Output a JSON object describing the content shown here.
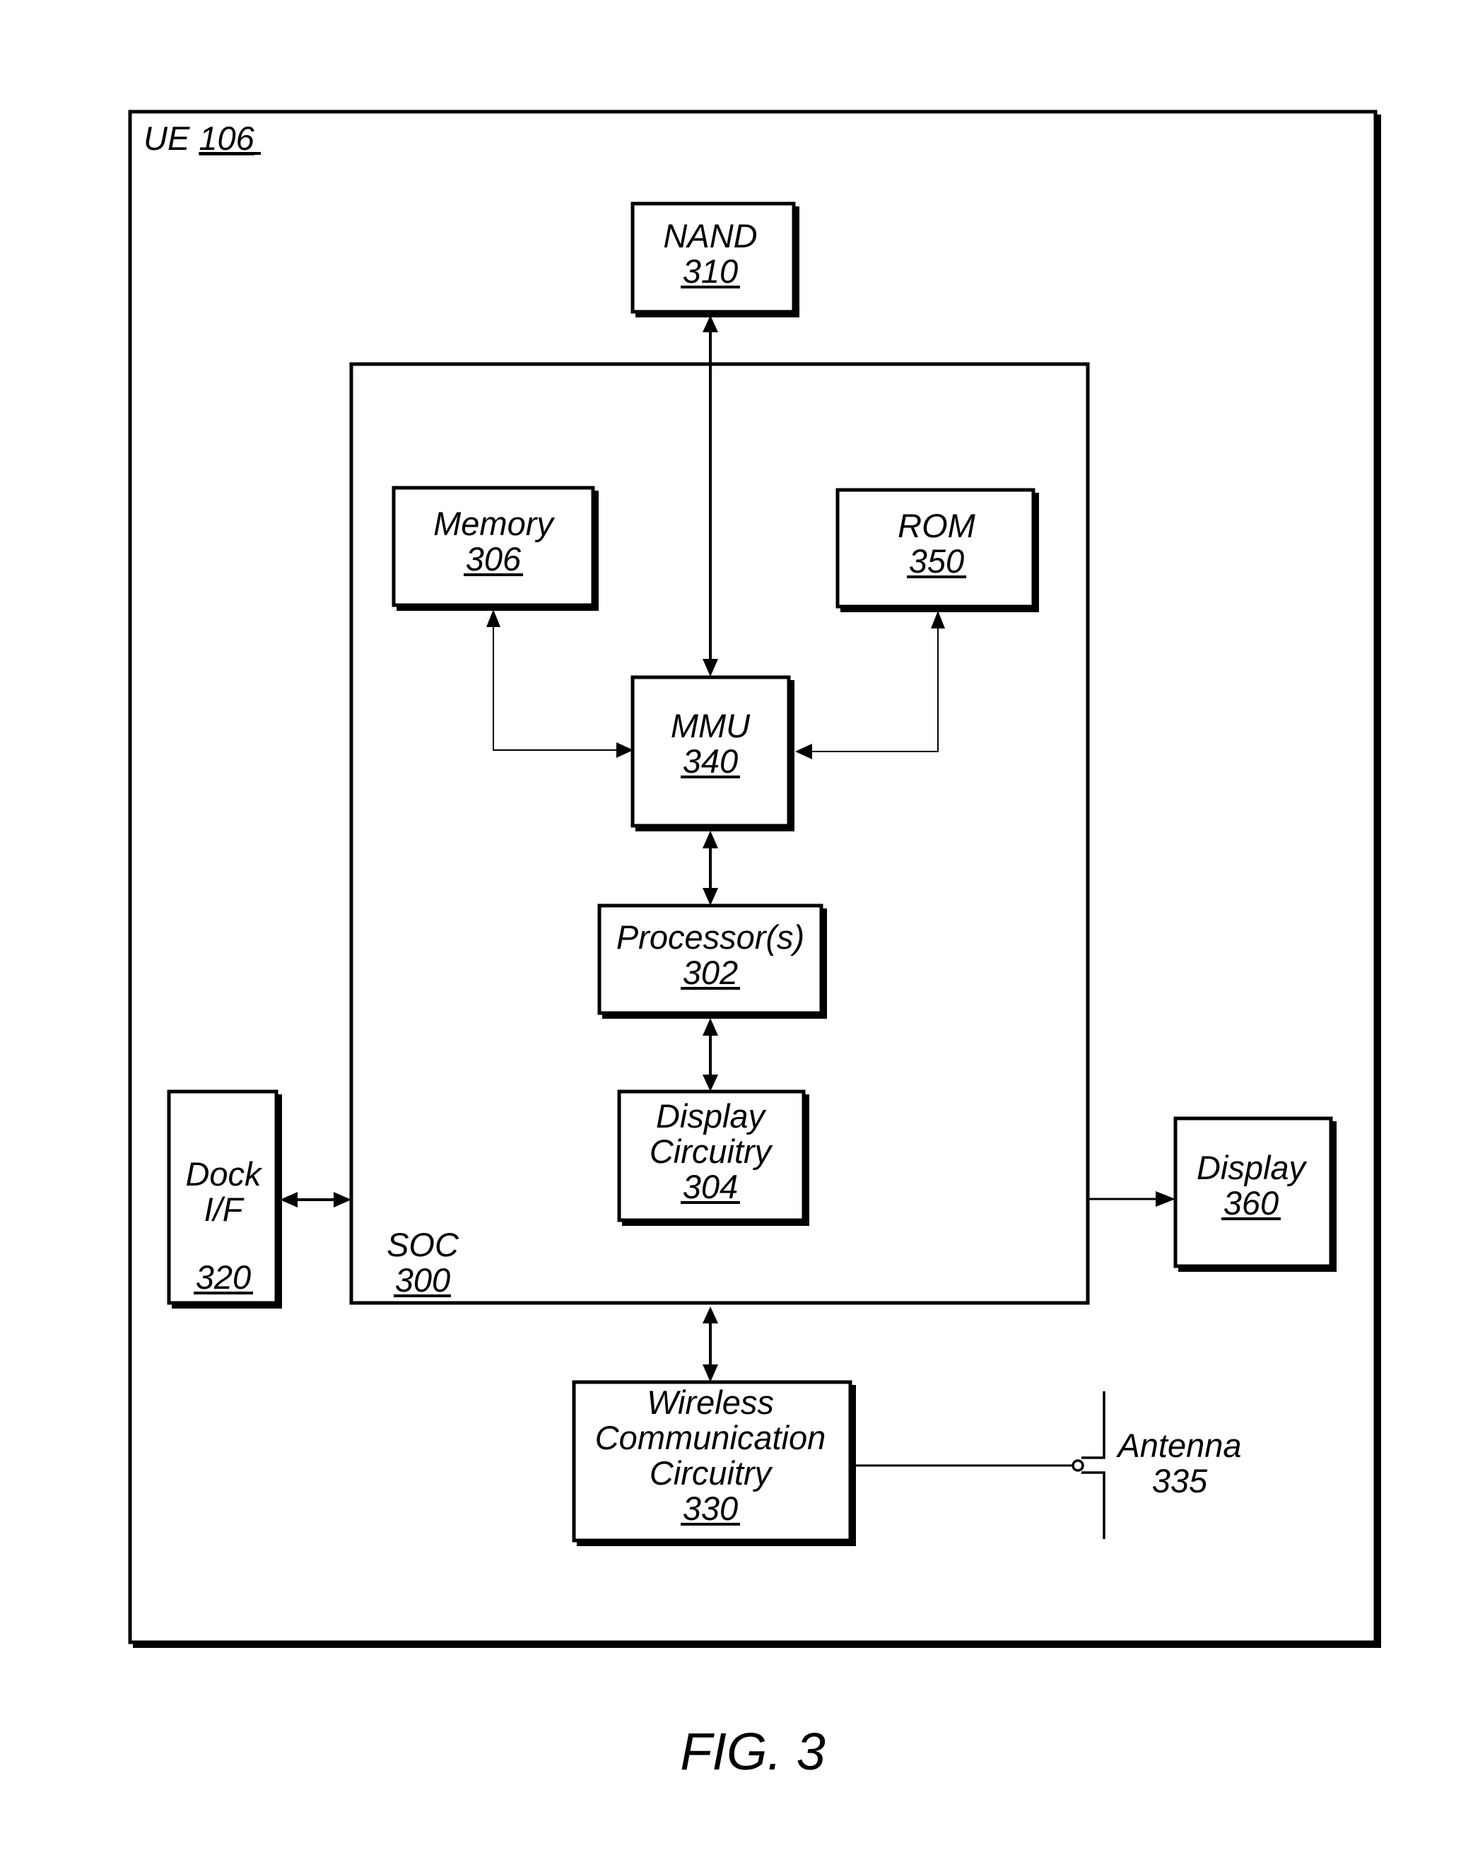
{
  "figure": {
    "caption": "FIG. 3"
  },
  "ue": {
    "name": "UE",
    "ref": "106"
  },
  "soc": {
    "name": "SOC",
    "ref": "300"
  },
  "blocks": {
    "nand": {
      "lines": [
        "NAND"
      ],
      "ref": "310"
    },
    "memory": {
      "lines": [
        "Memory"
      ],
      "ref": "306"
    },
    "rom": {
      "lines": [
        "ROM"
      ],
      "ref": "350"
    },
    "mmu": {
      "lines": [
        "MMU"
      ],
      "ref": "340"
    },
    "processor": {
      "lines": [
        "Processor(s)"
      ],
      "ref": "302"
    },
    "display_circuitry": {
      "lines": [
        "Display",
        "Circuitry"
      ],
      "ref": "304"
    },
    "dock": {
      "lines": [
        "Dock",
        "I/F"
      ],
      "ref": "320"
    },
    "display": {
      "lines": [
        "Display"
      ],
      "ref": "360"
    },
    "wireless": {
      "lines": [
        "Wireless",
        "Communication",
        "Circuitry"
      ],
      "ref": "330"
    }
  },
  "antenna": {
    "name": "Antenna",
    "ref": "335"
  },
  "connections": [
    {
      "from": "NAND 310",
      "to": "MMU 340",
      "type": "bidirectional"
    },
    {
      "from": "Memory 306",
      "to": "MMU 340",
      "type": "bidirectional"
    },
    {
      "from": "ROM 350",
      "to": "MMU 340",
      "type": "bidirectional"
    },
    {
      "from": "MMU 340",
      "to": "Processor(s) 302",
      "type": "bidirectional"
    },
    {
      "from": "Processor(s) 302",
      "to": "Display Circuitry 304",
      "type": "bidirectional"
    },
    {
      "from": "Dock I/F 320",
      "to": "SOC 300",
      "type": "bidirectional"
    },
    {
      "from": "SOC 300",
      "to": "Display 360",
      "type": "unidirectional"
    },
    {
      "from": "SOC 300",
      "to": "Wireless Communication Circuitry 330",
      "type": "bidirectional"
    },
    {
      "from": "Wireless Communication Circuitry 330",
      "to": "Antenna 335",
      "type": "line"
    }
  ]
}
